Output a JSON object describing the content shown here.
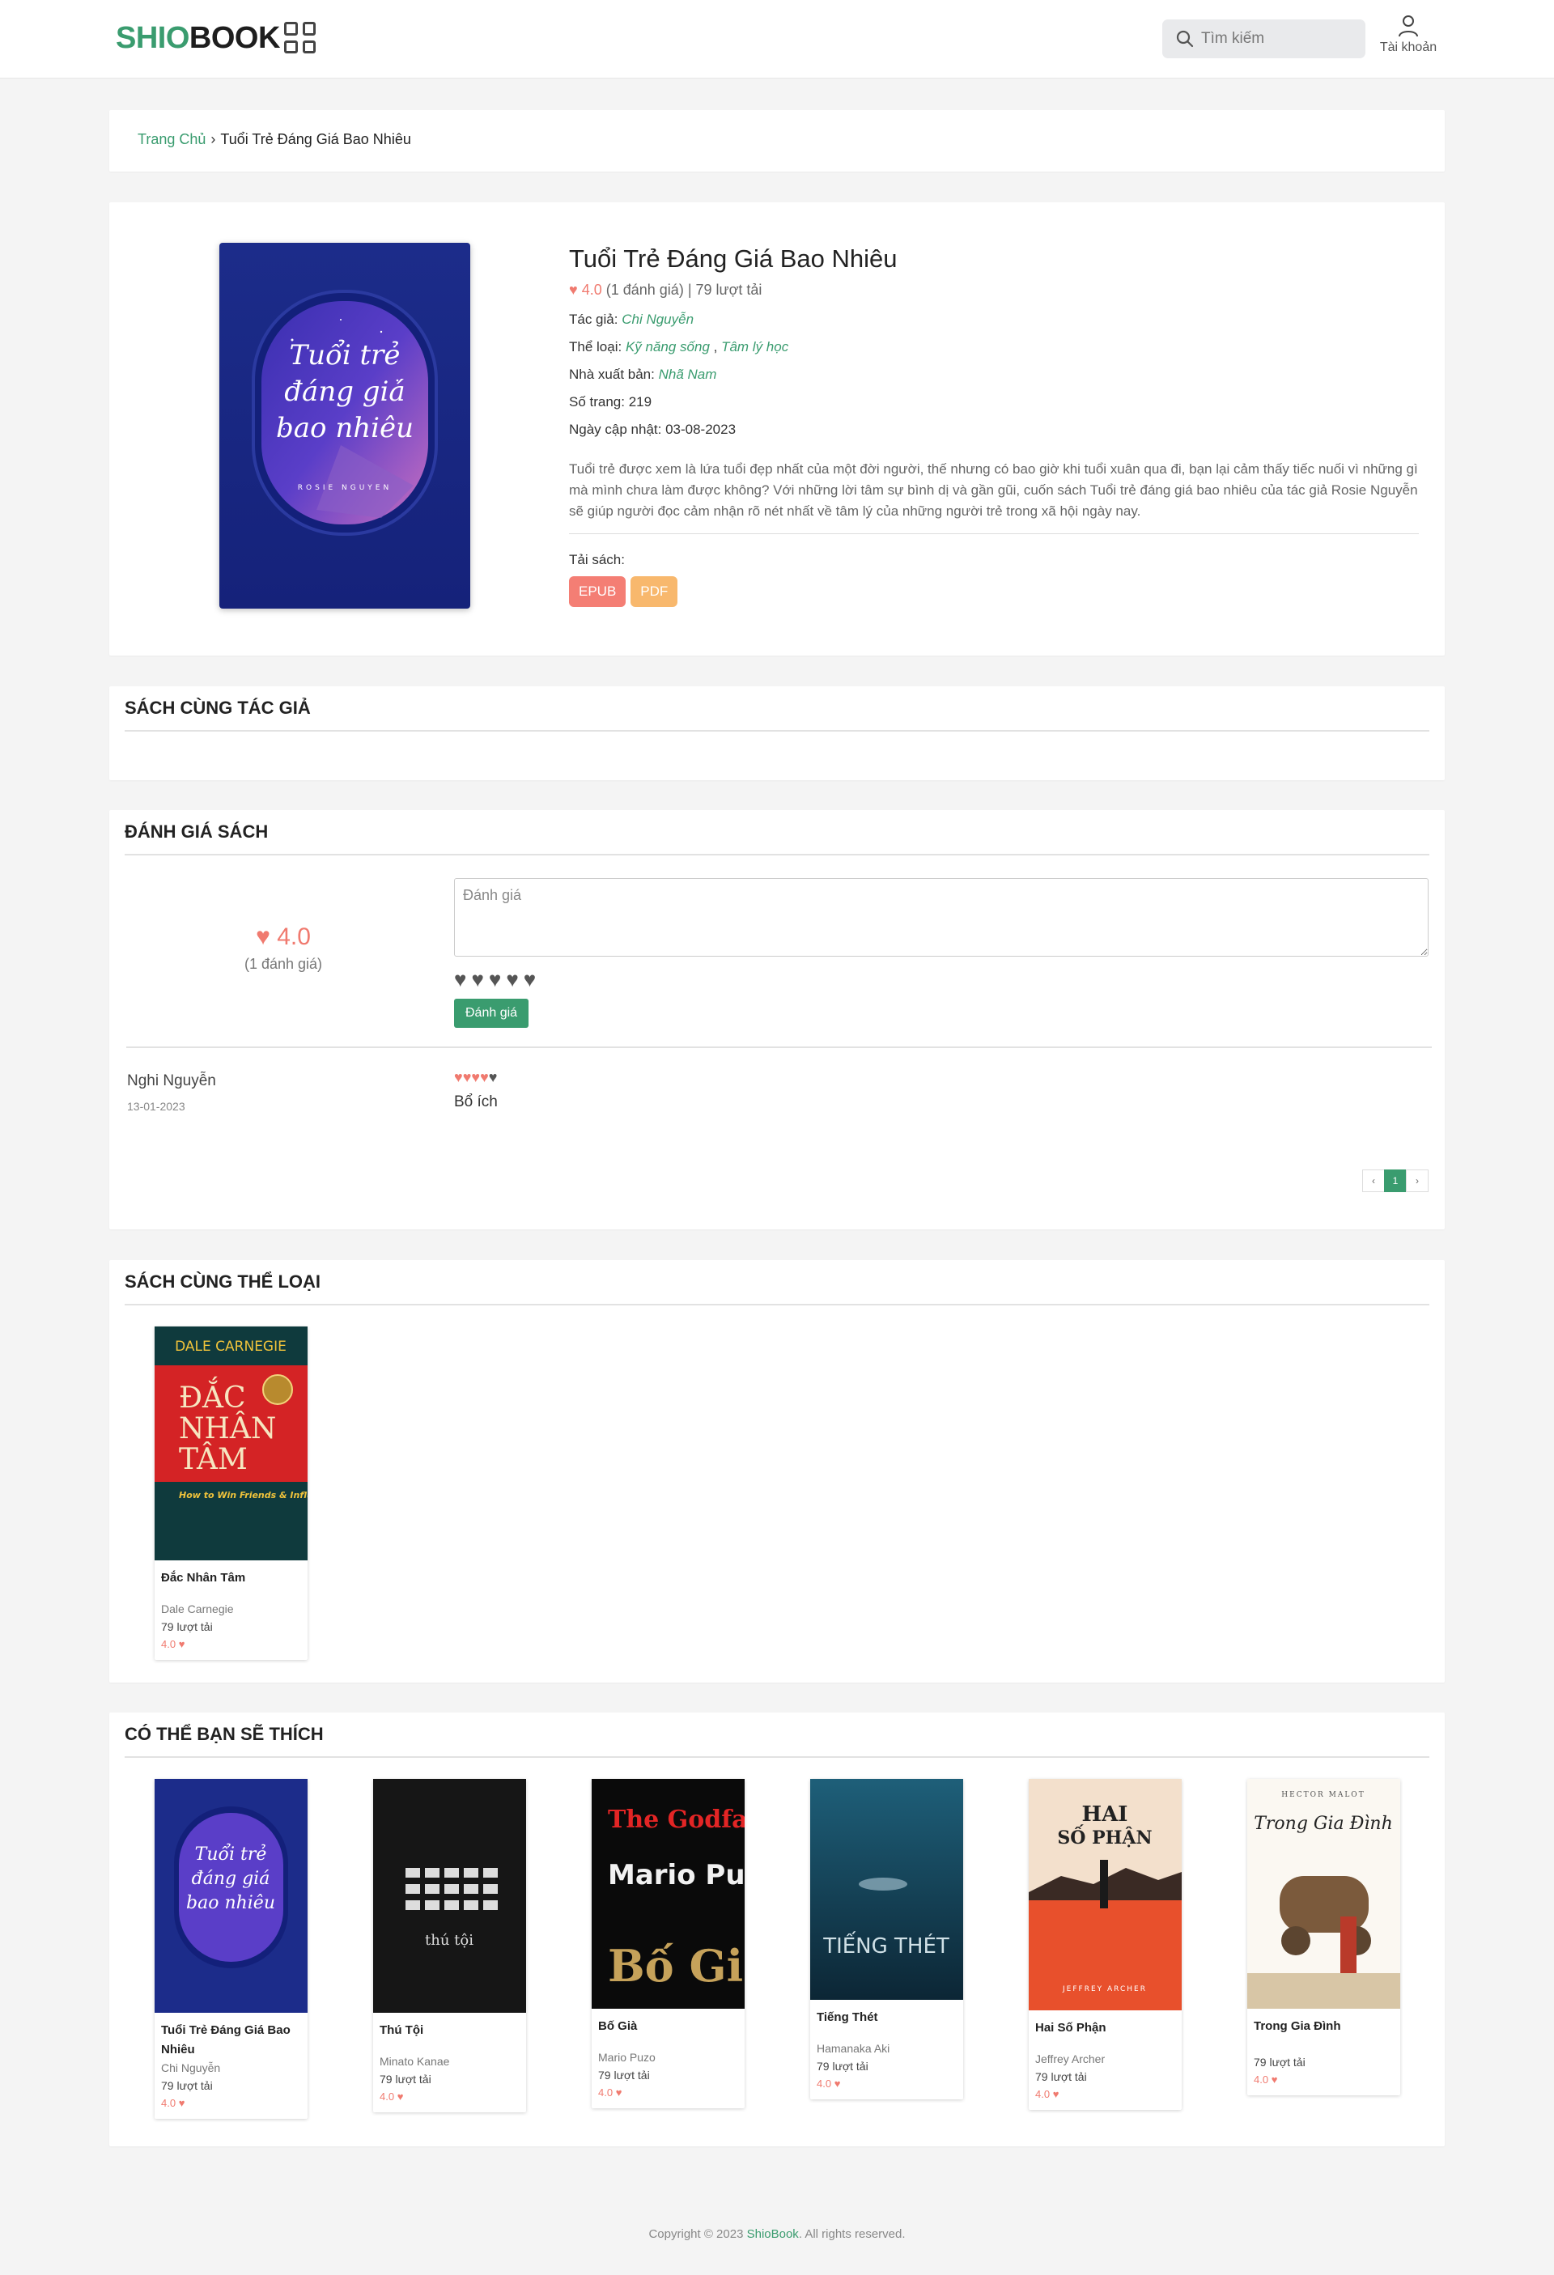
{
  "header": {
    "logo_part1": "SHIO",
    "logo_part2": "BOOK",
    "search_placeholder": "Tìm kiếm",
    "account_label": "Tài khoản"
  },
  "breadcrumb": {
    "home": "Trang Chủ",
    "current": "Tuổi Trẻ Đáng Giá Bao Nhiêu"
  },
  "book": {
    "title": "Tuổi Trẻ Đáng Giá Bao Nhiêu",
    "rating": "4.0",
    "rating_count": "(1 đánh giá)",
    "downloads": "| 79 lượt tải",
    "author_label": "Tác giả:",
    "author": "Chi Nguyễn",
    "genre_label": "Thể loại:",
    "genre_1": "Kỹ năng sống",
    "genre_2": "Tâm lý học",
    "publisher_label": "Nhà xuất bản:",
    "publisher": "Nhã Nam",
    "pages": "Số trang: 219",
    "updated": "Ngày cập nhật: 03-08-2023",
    "description": "Tuổi trẻ được xem là lứa tuổi đẹp nhất của một đời người, thế nhưng có bao giờ khi tuổi xuân qua đi, bạn lại cảm thấy tiếc nuối vì những gì mà mình chưa làm được không? Với những lời tâm sự bình dị và gần gũi, cuốn sách Tuổi trẻ đáng giá bao nhiêu của tác giả Rosie Nguyễn sẽ giúp người đọc cảm nhận rõ nét nhất về tâm lý của những người trẻ trong xã hội ngày nay.",
    "download_label": "Tải sách:",
    "btn_epub": "EPUB",
    "btn_pdf": "PDF",
    "cover_text_1": "Tuổi trẻ",
    "cover_text_2": "đáng giá",
    "cover_text_3": "bao nhiêu",
    "cover_author": "ROSIE NGUYEN"
  },
  "sections": {
    "same_author": "SÁCH CÙNG TÁC GIẢ",
    "review": "ĐÁNH GIÁ SÁCH",
    "same_category": "SÁCH CÙNG THỂ LOẠI",
    "suggest": "CÓ THỂ BẠN SẼ THÍCH"
  },
  "review": {
    "score": "4.0",
    "count": "(1 đánh giá)",
    "placeholder": "Đánh giá",
    "submit": "Đánh giá",
    "item_name": "Nghi Nguyễn",
    "item_date": "13-01-2023",
    "item_stars": 4,
    "item_text": "Bổ ích",
    "pager_prev": "‹",
    "pager_page": "1",
    "pager_next": "›"
  },
  "same_category_books": [
    {
      "name": "Đắc Nhân Tâm",
      "author": "Dale Carnegie",
      "downloads": "79 lượt tải",
      "rating": "4.0",
      "cover_top": "DALE CARNEGIE",
      "cover_title_1": "ĐẮC",
      "cover_title_2": "NHÂN",
      "cover_title_3": "TÂM",
      "cover_sub": "How to Win Friends & Influence People"
    }
  ],
  "suggest_books": [
    {
      "name": "Tuổi Trẻ Đáng Giá Bao Nhiêu",
      "author": "Chi Nguyễn",
      "downloads": "79 lượt tải",
      "rating": "4.0"
    },
    {
      "name": "Thú Tội",
      "author": "Minato Kanae",
      "downloads": "79 lượt tải",
      "rating": "4.0",
      "cover_text": "thú tội"
    },
    {
      "name": "Bố Già",
      "author": "Mario Puzo",
      "downloads": "79 lượt tải",
      "rating": "4.0",
      "cover_text_1": "The Godfather",
      "cover_text_2": "Mario Puzo",
      "cover_text_3": "Bố Già"
    },
    {
      "name": "Tiếng Thét",
      "author": "Hamanaka Aki",
      "downloads": "79 lượt tải",
      "rating": "4.0",
      "cover_text": "TIẾNG THÉT"
    },
    {
      "name": "Hai Số Phận",
      "author": "Jeffrey Archer",
      "downloads": "79 lượt tải",
      "rating": "4.0",
      "cover_text_1": "HAI",
      "cover_text_2": "SỐ PHẬN",
      "cover_text_3": "JEFFREY ARCHER"
    },
    {
      "name": "Trong Gia Đình",
      "author": "",
      "downloads": "79 lượt tải",
      "rating": "4.0",
      "cover_text_1": "HECTOR MALOT",
      "cover_text_2": "Trong Gia Đình"
    }
  ],
  "footer": {
    "prefix": "Copyright © 2023 ",
    "brand": "ShioBook",
    "suffix": ". All rights reserved."
  },
  "colors": {
    "accent": "#3a9c6f",
    "heart": "#f07a6f",
    "epub": "#f47e74",
    "pdf": "#f8b86d"
  }
}
